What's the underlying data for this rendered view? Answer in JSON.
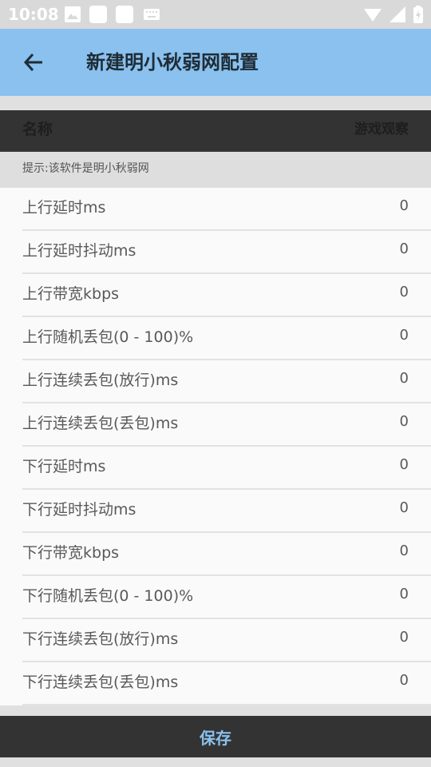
{
  "status_bar": {
    "time": "10:08",
    "notification_icons": [
      "image-icon",
      "app-icon",
      "app-icon",
      "keyboard-icon"
    ],
    "system_icons": [
      "wifi-icon",
      "signal-icon",
      "battery-icon"
    ]
  },
  "app_bar": {
    "back_icon": "arrow-left-icon",
    "title": "新建明小秋弱网配置",
    "color": "#8ac1ee"
  },
  "table_header": {
    "name": "名称",
    "game_watch": "游戏观察"
  },
  "hint": "提示:该软件是明小秋弱网",
  "settings": [
    {
      "label": "上行延时ms",
      "value": "0"
    },
    {
      "label": "上行延时抖动ms",
      "value": "0"
    },
    {
      "label": "上行带宽kbps",
      "value": "0"
    },
    {
      "label": "上行随机丢包(0 - 100)%",
      "value": "0"
    },
    {
      "label": "上行连续丢包(放行)ms",
      "value": "0"
    },
    {
      "label": "上行连续丢包(丢包)ms",
      "value": "0"
    },
    {
      "label": "下行延时ms",
      "value": "0"
    },
    {
      "label": "下行延时抖动ms",
      "value": "0"
    },
    {
      "label": "下行带宽kbps",
      "value": "0"
    },
    {
      "label": "下行随机丢包(0 - 100)%",
      "value": "0"
    },
    {
      "label": "下行连续丢包(放行)ms",
      "value": "0"
    },
    {
      "label": "下行连续丢包(丢包)ms",
      "value": "0"
    }
  ],
  "save_label": "保存"
}
